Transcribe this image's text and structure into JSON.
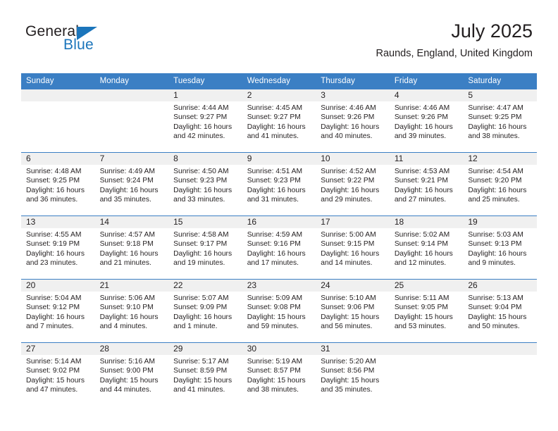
{
  "brand": {
    "name_part1": "General",
    "name_part2": "Blue",
    "accent_color": "#1b75bb"
  },
  "header": {
    "title": "July 2025",
    "subtitle": "Raunds, England, United Kingdom"
  },
  "theme": {
    "header_blue": "#3b7fc4",
    "daynum_band": "#f0f0f0",
    "text": "#231f20"
  },
  "calendar": {
    "columns": [
      "Sunday",
      "Monday",
      "Tuesday",
      "Wednesday",
      "Thursday",
      "Friday",
      "Saturday"
    ],
    "weeks": [
      [
        {
          "day": "",
          "sunrise": "",
          "sunset": "",
          "daylight": "",
          "empty": true
        },
        {
          "day": "",
          "sunrise": "",
          "sunset": "",
          "daylight": "",
          "empty": true
        },
        {
          "day": "1",
          "sunrise": "Sunrise: 4:44 AM",
          "sunset": "Sunset: 9:27 PM",
          "daylight": "Daylight: 16 hours and 42 minutes."
        },
        {
          "day": "2",
          "sunrise": "Sunrise: 4:45 AM",
          "sunset": "Sunset: 9:27 PM",
          "daylight": "Daylight: 16 hours and 41 minutes."
        },
        {
          "day": "3",
          "sunrise": "Sunrise: 4:46 AM",
          "sunset": "Sunset: 9:26 PM",
          "daylight": "Daylight: 16 hours and 40 minutes."
        },
        {
          "day": "4",
          "sunrise": "Sunrise: 4:46 AM",
          "sunset": "Sunset: 9:26 PM",
          "daylight": "Daylight: 16 hours and 39 minutes."
        },
        {
          "day": "5",
          "sunrise": "Sunrise: 4:47 AM",
          "sunset": "Sunset: 9:25 PM",
          "daylight": "Daylight: 16 hours and 38 minutes."
        }
      ],
      [
        {
          "day": "6",
          "sunrise": "Sunrise: 4:48 AM",
          "sunset": "Sunset: 9:25 PM",
          "daylight": "Daylight: 16 hours and 36 minutes."
        },
        {
          "day": "7",
          "sunrise": "Sunrise: 4:49 AM",
          "sunset": "Sunset: 9:24 PM",
          "daylight": "Daylight: 16 hours and 35 minutes."
        },
        {
          "day": "8",
          "sunrise": "Sunrise: 4:50 AM",
          "sunset": "Sunset: 9:23 PM",
          "daylight": "Daylight: 16 hours and 33 minutes."
        },
        {
          "day": "9",
          "sunrise": "Sunrise: 4:51 AM",
          "sunset": "Sunset: 9:23 PM",
          "daylight": "Daylight: 16 hours and 31 minutes."
        },
        {
          "day": "10",
          "sunrise": "Sunrise: 4:52 AM",
          "sunset": "Sunset: 9:22 PM",
          "daylight": "Daylight: 16 hours and 29 minutes."
        },
        {
          "day": "11",
          "sunrise": "Sunrise: 4:53 AM",
          "sunset": "Sunset: 9:21 PM",
          "daylight": "Daylight: 16 hours and 27 minutes."
        },
        {
          "day": "12",
          "sunrise": "Sunrise: 4:54 AM",
          "sunset": "Sunset: 9:20 PM",
          "daylight": "Daylight: 16 hours and 25 minutes."
        }
      ],
      [
        {
          "day": "13",
          "sunrise": "Sunrise: 4:55 AM",
          "sunset": "Sunset: 9:19 PM",
          "daylight": "Daylight: 16 hours and 23 minutes."
        },
        {
          "day": "14",
          "sunrise": "Sunrise: 4:57 AM",
          "sunset": "Sunset: 9:18 PM",
          "daylight": "Daylight: 16 hours and 21 minutes."
        },
        {
          "day": "15",
          "sunrise": "Sunrise: 4:58 AM",
          "sunset": "Sunset: 9:17 PM",
          "daylight": "Daylight: 16 hours and 19 minutes."
        },
        {
          "day": "16",
          "sunrise": "Sunrise: 4:59 AM",
          "sunset": "Sunset: 9:16 PM",
          "daylight": "Daylight: 16 hours and 17 minutes."
        },
        {
          "day": "17",
          "sunrise": "Sunrise: 5:00 AM",
          "sunset": "Sunset: 9:15 PM",
          "daylight": "Daylight: 16 hours and 14 minutes."
        },
        {
          "day": "18",
          "sunrise": "Sunrise: 5:02 AM",
          "sunset": "Sunset: 9:14 PM",
          "daylight": "Daylight: 16 hours and 12 minutes."
        },
        {
          "day": "19",
          "sunrise": "Sunrise: 5:03 AM",
          "sunset": "Sunset: 9:13 PM",
          "daylight": "Daylight: 16 hours and 9 minutes."
        }
      ],
      [
        {
          "day": "20",
          "sunrise": "Sunrise: 5:04 AM",
          "sunset": "Sunset: 9:12 PM",
          "daylight": "Daylight: 16 hours and 7 minutes."
        },
        {
          "day": "21",
          "sunrise": "Sunrise: 5:06 AM",
          "sunset": "Sunset: 9:10 PM",
          "daylight": "Daylight: 16 hours and 4 minutes."
        },
        {
          "day": "22",
          "sunrise": "Sunrise: 5:07 AM",
          "sunset": "Sunset: 9:09 PM",
          "daylight": "Daylight: 16 hours and 1 minute."
        },
        {
          "day": "23",
          "sunrise": "Sunrise: 5:09 AM",
          "sunset": "Sunset: 9:08 PM",
          "daylight": "Daylight: 15 hours and 59 minutes."
        },
        {
          "day": "24",
          "sunrise": "Sunrise: 5:10 AM",
          "sunset": "Sunset: 9:06 PM",
          "daylight": "Daylight: 15 hours and 56 minutes."
        },
        {
          "day": "25",
          "sunrise": "Sunrise: 5:11 AM",
          "sunset": "Sunset: 9:05 PM",
          "daylight": "Daylight: 15 hours and 53 minutes."
        },
        {
          "day": "26",
          "sunrise": "Sunrise: 5:13 AM",
          "sunset": "Sunset: 9:04 PM",
          "daylight": "Daylight: 15 hours and 50 minutes."
        }
      ],
      [
        {
          "day": "27",
          "sunrise": "Sunrise: 5:14 AM",
          "sunset": "Sunset: 9:02 PM",
          "daylight": "Daylight: 15 hours and 47 minutes."
        },
        {
          "day": "28",
          "sunrise": "Sunrise: 5:16 AM",
          "sunset": "Sunset: 9:00 PM",
          "daylight": "Daylight: 15 hours and 44 minutes."
        },
        {
          "day": "29",
          "sunrise": "Sunrise: 5:17 AM",
          "sunset": "Sunset: 8:59 PM",
          "daylight": "Daylight: 15 hours and 41 minutes."
        },
        {
          "day": "30",
          "sunrise": "Sunrise: 5:19 AM",
          "sunset": "Sunset: 8:57 PM",
          "daylight": "Daylight: 15 hours and 38 minutes."
        },
        {
          "day": "31",
          "sunrise": "Sunrise: 5:20 AM",
          "sunset": "Sunset: 8:56 PM",
          "daylight": "Daylight: 15 hours and 35 minutes."
        },
        {
          "day": "",
          "sunrise": "",
          "sunset": "",
          "daylight": "",
          "empty": true
        },
        {
          "day": "",
          "sunrise": "",
          "sunset": "",
          "daylight": "",
          "empty": true
        }
      ]
    ]
  }
}
